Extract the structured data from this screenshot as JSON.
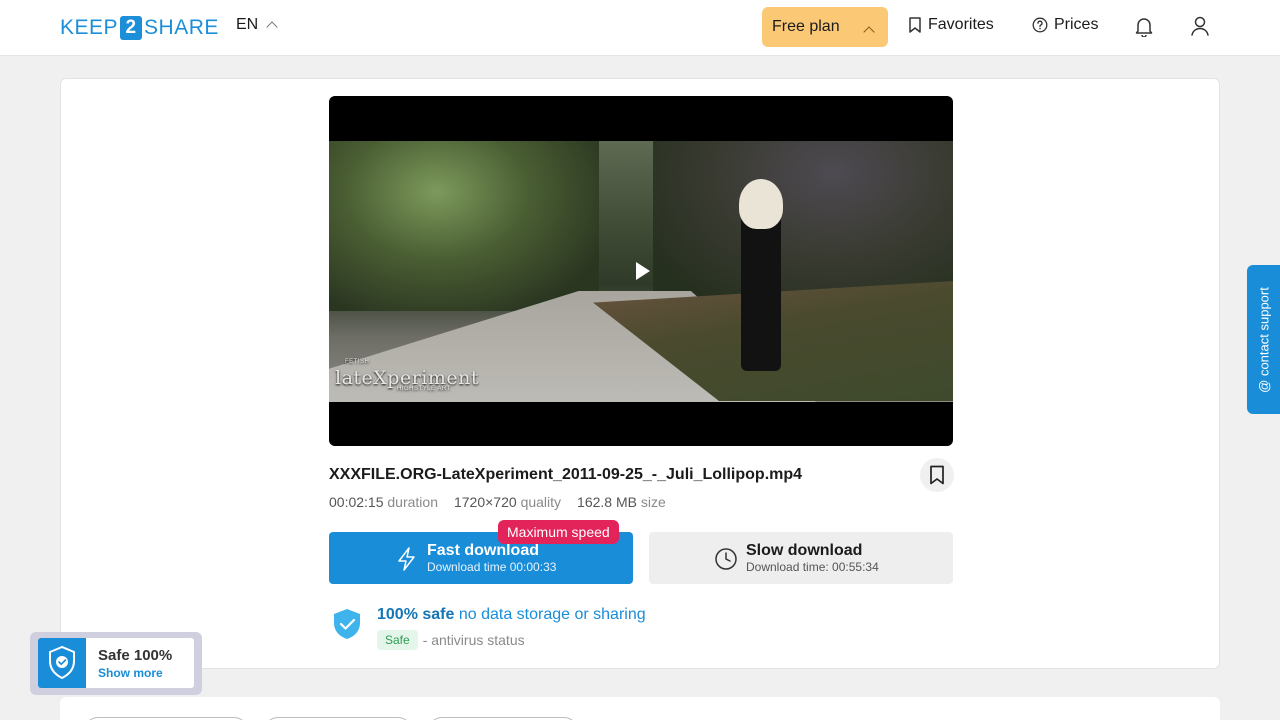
{
  "header": {
    "logo_left": "KEEP",
    "logo_num": "2",
    "logo_right": "SHARE",
    "lang": "EN",
    "plan_label": "Free plan",
    "favorites_label": "Favorites",
    "prices_label": "Prices"
  },
  "file": {
    "name": "XXXFILE.ORG-LateXperiment_2011-09-25_-_Juli_Lollipop.mp4",
    "duration_value": "00:02:15",
    "duration_label": "duration",
    "quality_value": "1720×720",
    "quality_label": "quality",
    "size_value": "162.8 MB",
    "size_label": "size"
  },
  "video": {
    "watermark_small": "FETISH",
    "watermark": "lateXperiment",
    "watermark_sub": "HIGHSTYLE ART"
  },
  "download": {
    "badge": "Maximum speed",
    "fast_title": "Fast download",
    "fast_sub": "Download time 00:00:33",
    "slow_title": "Slow download",
    "slow_sub": "Download time: 00:55:34"
  },
  "safety": {
    "bold": "100% safe",
    "rest": "no data storage or sharing",
    "status_pill": "Safe",
    "status_text": "- antivirus status"
  },
  "support_tab": "@ contact support",
  "safe_widget": {
    "title": "Safe 100%",
    "link": "Show more"
  },
  "colors": {
    "accent": "#1a8dd8",
    "plan_bg": "#fbc976",
    "badge": "#e3245a"
  }
}
